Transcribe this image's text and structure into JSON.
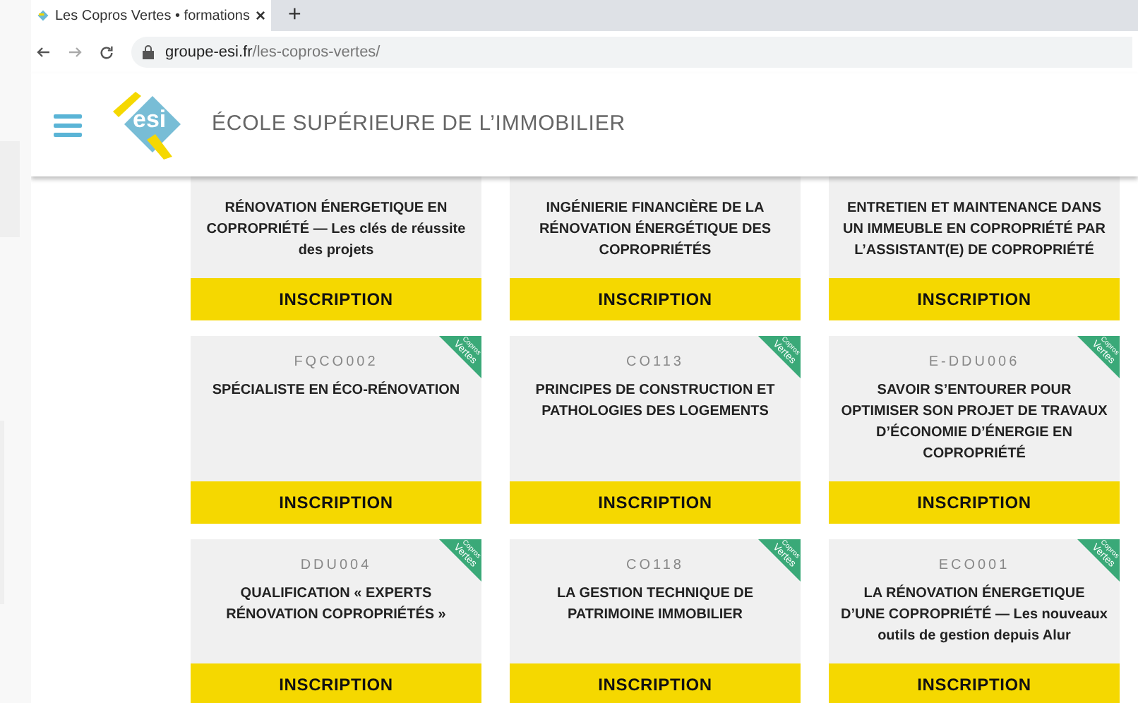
{
  "browser": {
    "tab_title": "Les Copros Vertes • formations",
    "close": "×",
    "new_tab": "+",
    "url_host": "groupe-esi.fr",
    "url_path": "/les-copros-vertes/"
  },
  "header": {
    "logo_text": "esi",
    "title": "ÉCOLE SUPÉRIEURE DE L’IMMOBILIER"
  },
  "cards": [
    {
      "title": "RÉNOVATION ÉNERGETIQUE EN COPROPRIÉTÉ — Les clés de réussite des projets",
      "button": "INSCRIPTION"
    },
    {
      "title": "INGÉNIERIE FINANCIÈRE DE LA RÉNOVATION ÉNERGÉTIQUE DES COPROPRIÉTÉS",
      "button": "INSCRIPTION"
    },
    {
      "title": "ENTRETIEN ET MAINTENANCE DANS UN IMMEUBLE EN COPROPRIÉTÉ PAR L’ASSISTANT(E) DE COPROPRIÉTÉ",
      "button": "INSCRIPTION"
    },
    {
      "code": "FQCO002",
      "ribbon": [
        "Copros",
        "Vertes"
      ],
      "title": "SPÉCIALISTE EN ÉCO-RÉNOVATION",
      "button": "INSCRIPTION"
    },
    {
      "code": "CO113",
      "ribbon": [
        "Copros",
        "Vertes"
      ],
      "title": "PRINCIPES DE CONSTRUCTION ET PATHOLOGIES DES LOGEMENTS",
      "button": "INSCRIPTION"
    },
    {
      "code": "E-DDU006",
      "ribbon": [
        "Copros",
        "Vertes"
      ],
      "title": "SAVOIR S’ENTOURER POUR OPTIMISER SON PROJET DE TRAVAUX D’ÉCONOMIE D’ÉNERGIE EN COPROPRIÉTÉ",
      "button": "INSCRIPTION"
    },
    {
      "code": "DDU004",
      "ribbon": [
        "Copros",
        "Vertes"
      ],
      "title": "QUALIFICATION « EXPERTS RÉNOVATION COPROPRIÉTÉS »",
      "button": "INSCRIPTION"
    },
    {
      "code": "CO118",
      "ribbon": [
        "Copros",
        "Vertes"
      ],
      "title": "LA GESTION TECHNIQUE DE PATRIMOINE IMMOBILIER",
      "button": "INSCRIPTION"
    },
    {
      "code": "ECO001",
      "ribbon": [
        "Copros",
        "Vertes"
      ],
      "title": "LA RÉNOVATION ÉNERGETIQUE D’UNE COPROPRIÉTÉ — Les nouveaux outils de gestion depuis Alur",
      "button": "INSCRIPTION"
    }
  ]
}
